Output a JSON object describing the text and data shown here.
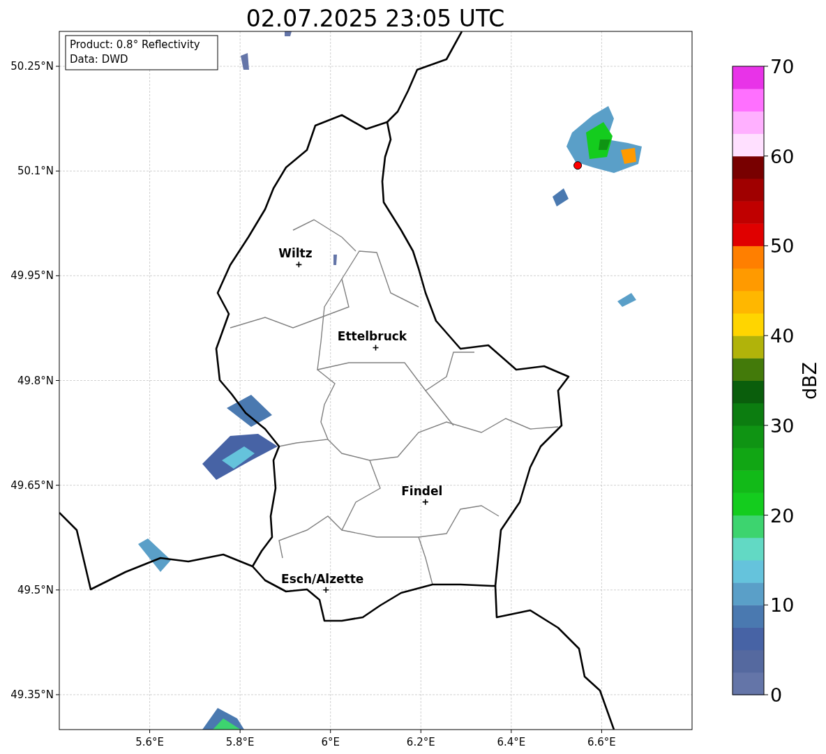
{
  "title": "02.07.2025 23:05 UTC",
  "map": {
    "info_box": [
      "Product: 0.8° Reflectivity",
      "Data: DWD"
    ],
    "chart_data": {
      "type": "scatter",
      "grid": true,
      "xlim": [
        5.4,
        6.8
      ],
      "ylim": [
        49.3,
        50.3
      ],
      "xticks": [
        {
          "value": 5.6,
          "label": "5.6°E"
        },
        {
          "value": 5.8,
          "label": "5.8°E"
        },
        {
          "value": 6.0,
          "label": "6°E"
        },
        {
          "value": 6.2,
          "label": "6.2°E"
        },
        {
          "value": 6.4,
          "label": "6.4°E"
        },
        {
          "value": 6.6,
          "label": "6.6°E"
        }
      ],
      "yticks": [
        {
          "value": 49.35,
          "label": "49.35°N"
        },
        {
          "value": 49.5,
          "label": "49.5°N"
        },
        {
          "value": 49.65,
          "label": "49.65°N"
        },
        {
          "value": 49.8,
          "label": "49.8°N"
        },
        {
          "value": 49.95,
          "label": "49.95°N"
        },
        {
          "value": 50.1,
          "label": "50.1°N"
        },
        {
          "value": 50.25,
          "label": "50.25°N"
        }
      ],
      "series": [
        {
          "color": "#000000",
          "x": [
            5.93,
            6.1,
            6.21,
            5.99
          ],
          "values": [
            49.966,
            49.847,
            49.626,
            49.5
          ]
        },
        {
          "color": "#ff0000",
          "x": [
            6.547
          ],
          "values": [
            50.108
          ]
        }
      ],
      "annotations": [
        {
          "text": "Wiltz",
          "x": 5.93,
          "y": 49.966
        },
        {
          "text": "Ettelbruck",
          "x": 6.1,
          "y": 49.847
        },
        {
          "text": "Findel",
          "x": 6.21,
          "y": 49.626
        },
        {
          "text": "Esch/Alzette",
          "x": 5.99,
          "y": 49.5
        }
      ]
    }
  },
  "colorbar": {
    "label": "dBZ",
    "ticks": [
      "70",
      "60",
      "50",
      "40",
      "30",
      "20",
      "10",
      "0"
    ],
    "bands": [
      {
        "color": "#6475a8"
      },
      {
        "color": "#55699f"
      },
      {
        "color": "#4763a5"
      },
      {
        "color": "#4a79b0"
      },
      {
        "color": "#5a9fc8"
      },
      {
        "color": "#65c3dc"
      },
      {
        "color": "#62d9c4"
      },
      {
        "color": "#3dd46f"
      },
      {
        "color": "#14cc1e"
      },
      {
        "color": "#12ba18"
      },
      {
        "color": "#11a614"
      },
      {
        "color": "#0f9413"
      },
      {
        "color": "#0c7d10"
      },
      {
        "color": "#0a5e0c"
      },
      {
        "color": "#437a0a"
      },
      {
        "color": "#b1b30a"
      },
      {
        "color": "#ffd500"
      },
      {
        "color": "#ffb700"
      },
      {
        "color": "#ff9a00"
      },
      {
        "color": "#ff7f00"
      },
      {
        "color": "#e00000"
      },
      {
        "color": "#c00000"
      },
      {
        "color": "#a00000"
      },
      {
        "color": "#780000"
      },
      {
        "color": "#ffe0ff"
      },
      {
        "color": "#ffb0ff"
      },
      {
        "color": "#ff70ff"
      },
      {
        "color": "#e833e8"
      }
    ]
  }
}
